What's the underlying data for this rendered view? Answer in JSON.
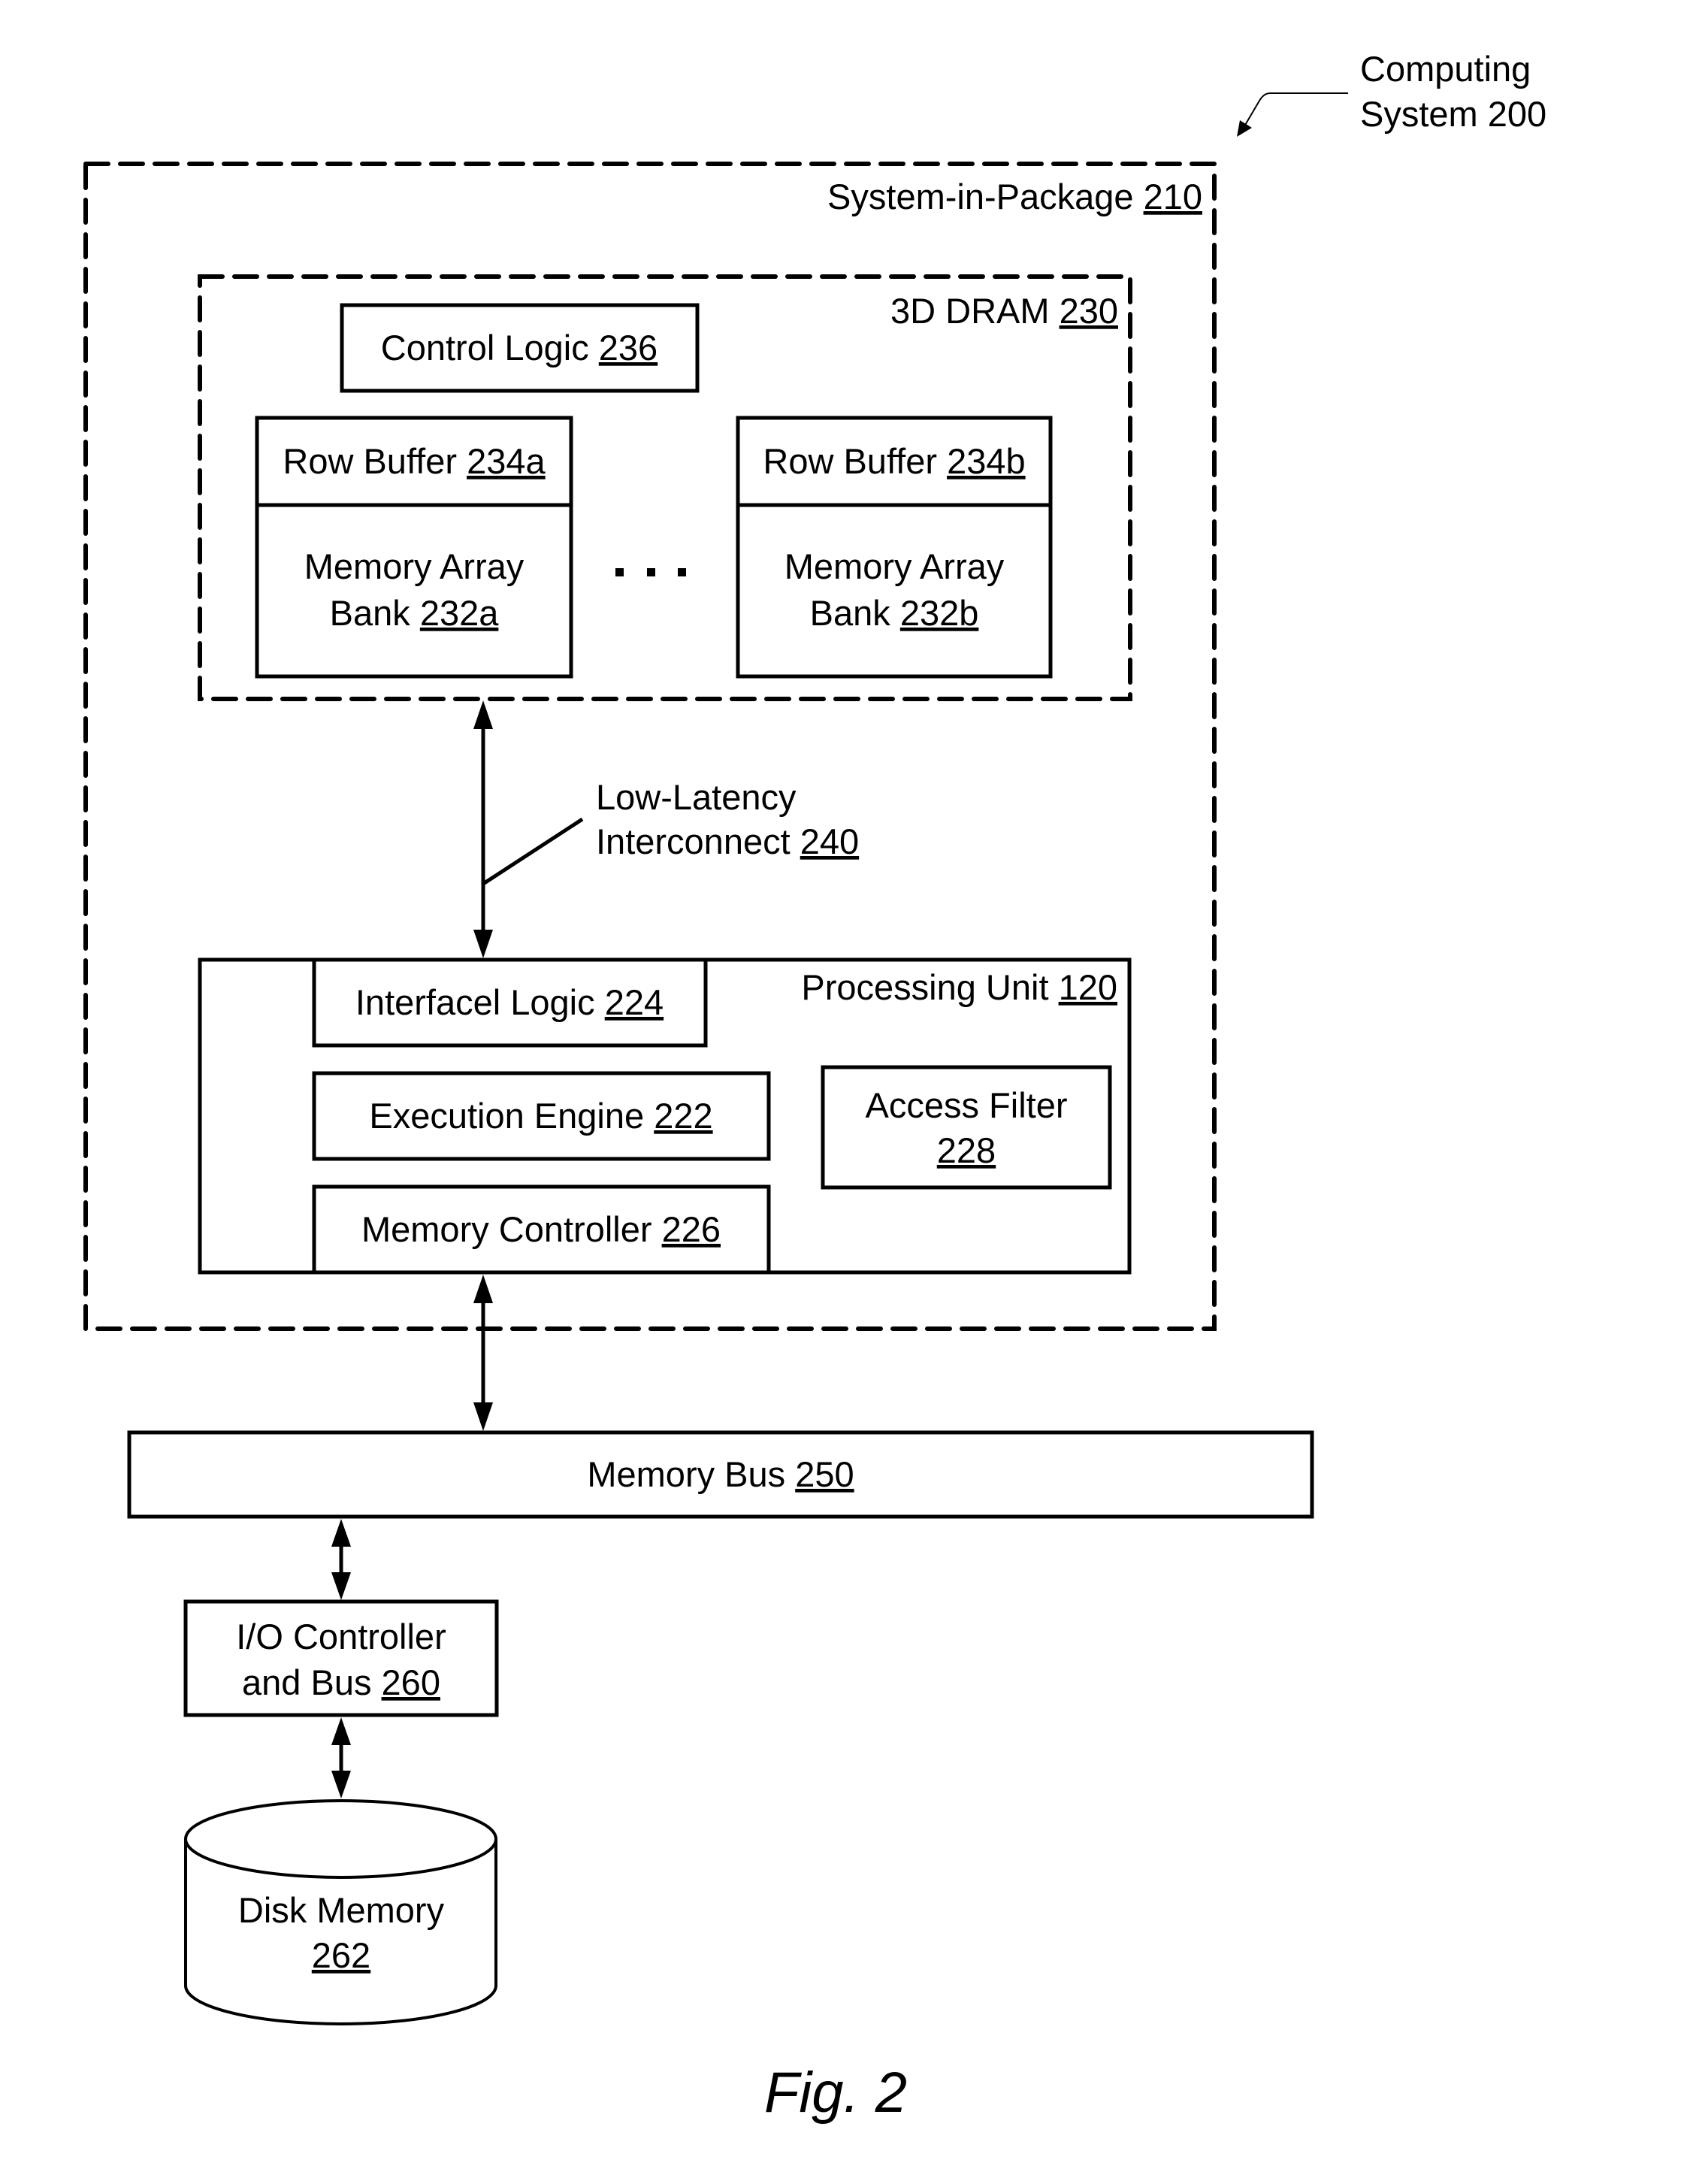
{
  "figure_label": "Fig. 2",
  "computing_system": {
    "line1": "Computing",
    "line2": "System 200"
  },
  "system_in_package": {
    "name": "System-in-Package ",
    "ref": "210"
  },
  "dram": {
    "name": "3D DRAM ",
    "ref": "230",
    "control_logic": {
      "name": "Control Logic ",
      "ref": "236"
    },
    "banks": [
      {
        "row_buffer": {
          "name": "Row Buffer ",
          "ref": "234a"
        },
        "array_line1": "Memory Array",
        "array_line2": "Bank ",
        "array_ref": "232a"
      },
      {
        "row_buffer": {
          "name": "Row Buffer ",
          "ref": "234b"
        },
        "array_line1": "Memory Array",
        "array_line2": "Bank ",
        "array_ref": "232b"
      }
    ],
    "ellipsis": "..."
  },
  "interconnect": {
    "line1": "Low-Latency",
    "line2": "Interconnect ",
    "ref": "240"
  },
  "processing_unit": {
    "name": "Processing Unit ",
    "ref": "120",
    "interface_logic": {
      "name": "Interfacel Logic ",
      "ref": "224"
    },
    "execution_engine": {
      "name": "Execution Engine ",
      "ref": "222"
    },
    "memory_controller": {
      "name": "Memory Controller ",
      "ref": "226"
    },
    "access_filter": {
      "line1": "Access Filter",
      "ref": "228"
    }
  },
  "memory_bus": {
    "name": "Memory Bus ",
    "ref": "250"
  },
  "io_controller": {
    "line1": "I/O Controller",
    "line2": "and Bus ",
    "ref": "260"
  },
  "disk_memory": {
    "line1": "Disk Memory",
    "ref": "262"
  }
}
